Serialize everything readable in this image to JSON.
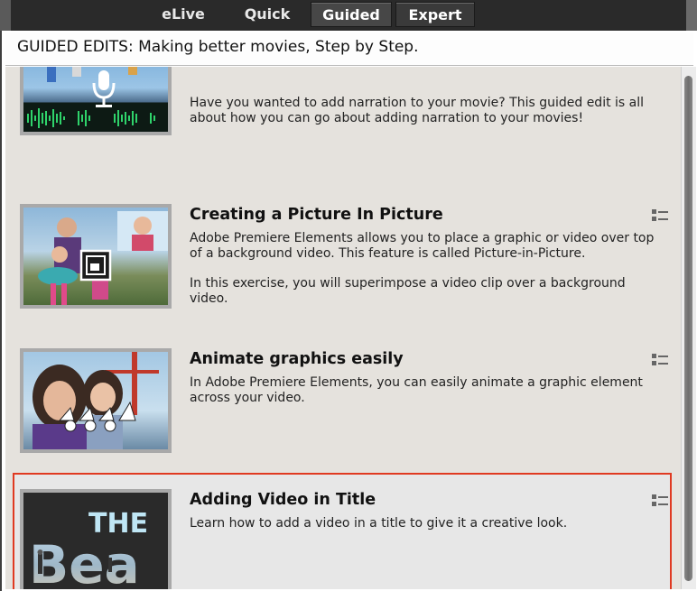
{
  "modes": {
    "tabs": [
      {
        "label": "eLive"
      },
      {
        "label": "Quick"
      },
      {
        "label": "Guided",
        "active": true
      },
      {
        "label": "Expert"
      }
    ]
  },
  "panel": {
    "title": "GUIDED EDITS: Making better movies, Step by Step."
  },
  "items": [
    {
      "title": "",
      "desc": [
        "Have you wanted to add narration to your movie? This guided edit is all about how you can go about adding narration to your movies!"
      ]
    },
    {
      "title": "Creating a Picture In Picture",
      "desc": [
        "Adobe Premiere Elements allows you to place a graphic or video over top of a background video. This feature is called Picture-in-Picture.",
        "In this exercise, you will superimpose a video clip over a background video."
      ]
    },
    {
      "title": "Animate graphics easily",
      "desc": [
        "In Adobe Premiere Elements, you can easily animate a graphic element across your video."
      ]
    },
    {
      "title": "Adding Video in Title",
      "desc": [
        "Learn how to add a video in a title to give it a creative look."
      ],
      "thumb_text": {
        "line1": "THE",
        "line2": "Bea"
      }
    }
  ],
  "icons": {
    "menu": "list-menu-icon",
    "mic": "microphone-icon",
    "pip": "picture-in-picture-icon",
    "animate": "keyframe-animation-icon"
  },
  "colors": {
    "selection": "#e03a21",
    "active_tab": "#474747",
    "list_bg": "#e5e2dd"
  }
}
